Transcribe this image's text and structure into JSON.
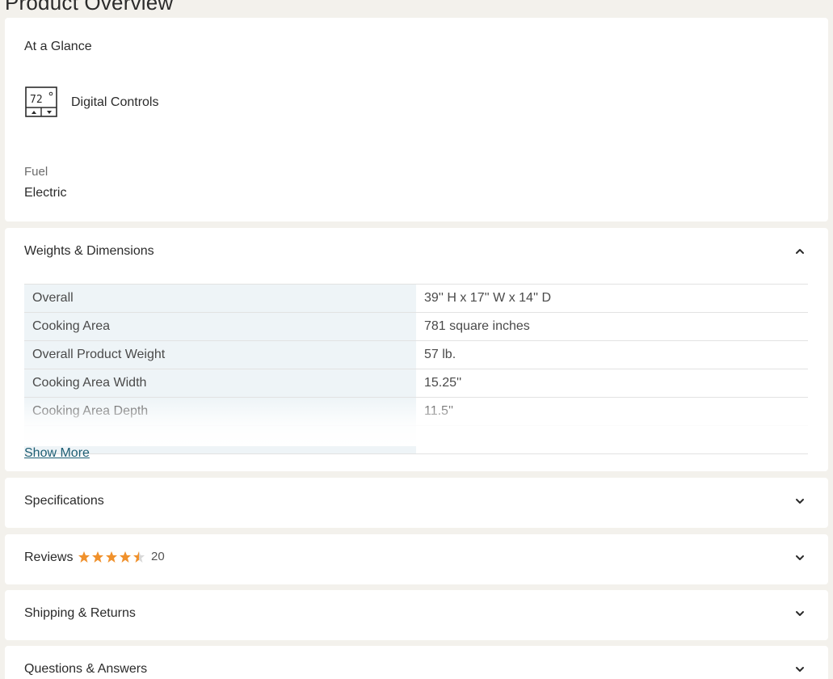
{
  "page_title": "Product Overview",
  "at_a_glance": {
    "title": "At a Glance",
    "feature": {
      "icon": "digital-thermostat-icon",
      "label": "Digital Controls"
    },
    "fuel_label": "Fuel",
    "fuel_value": "Electric"
  },
  "weights_dimensions": {
    "title": "Weights & Dimensions",
    "expanded": true,
    "rows": [
      {
        "label": "Overall",
        "value": "39'' H x 17'' W x 14'' D"
      },
      {
        "label": "Cooking Area",
        "value": "781 square inches"
      },
      {
        "label": "Overall Product Weight",
        "value": "57 lb."
      },
      {
        "label": "Cooking Area Width",
        "value": "15.25''"
      },
      {
        "label": "Cooking Area Depth",
        "value": "11.5''"
      }
    ],
    "show_more": "Show More"
  },
  "specifications": {
    "title": "Specifications"
  },
  "reviews": {
    "title": "Reviews",
    "rating": 4.5,
    "count": "20",
    "star_color": "#f0912c"
  },
  "shipping": {
    "title": "Shipping & Returns"
  },
  "questions": {
    "title": "Questions & Answers"
  }
}
